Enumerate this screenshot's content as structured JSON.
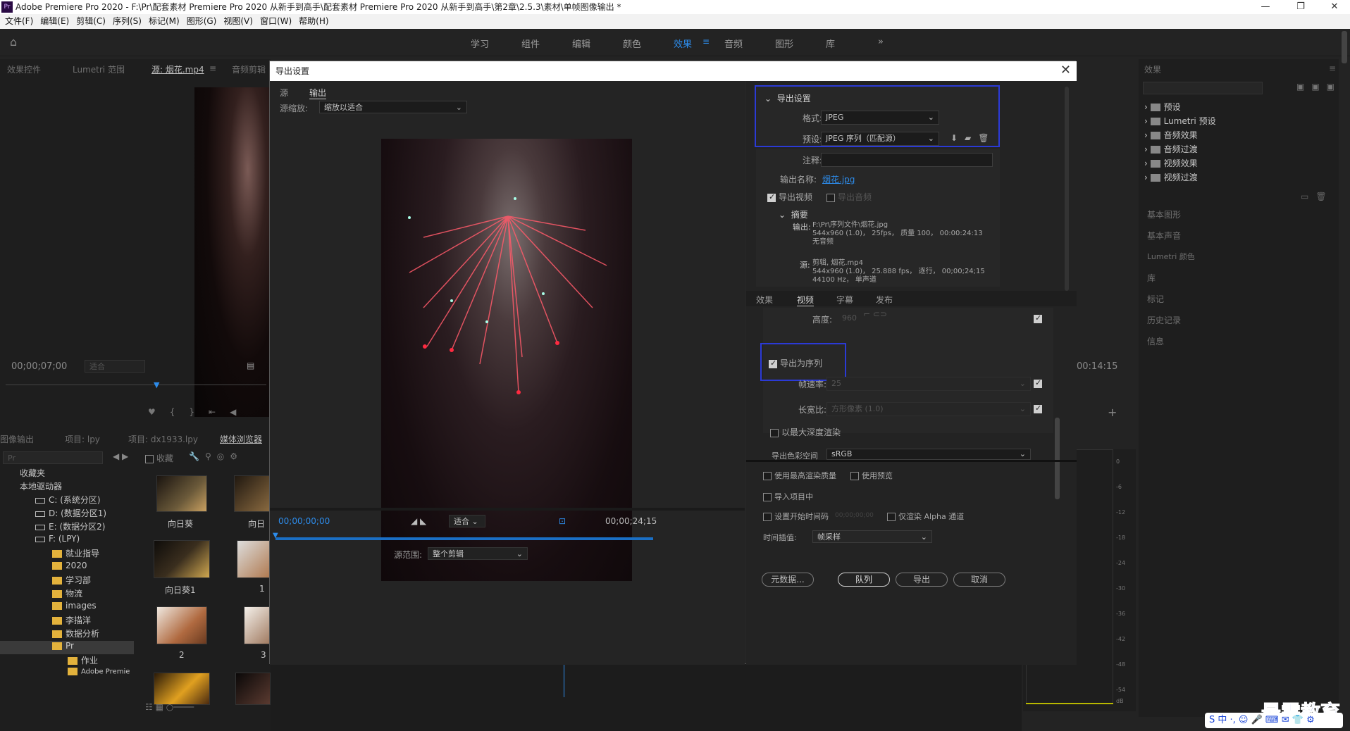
{
  "window": {
    "title": "Adobe Premiere Pro 2020 - F:\\Pr\\配套素材 Premiere Pro 2020 从新手到高手\\配套素材 Premiere Pro 2020 从新手到高手\\第2章\\2.5.3\\素材\\单帧图像输出 *"
  },
  "menu": [
    "文件(F)",
    "编辑(E)",
    "剪辑(C)",
    "序列(S)",
    "标记(M)",
    "图形(G)",
    "视图(V)",
    "窗口(W)",
    "帮助(H)"
  ],
  "workspaces": [
    "学习",
    "组件",
    "编辑",
    "颜色",
    "效果",
    "音频",
    "图形",
    "库"
  ],
  "active_workspace": "效果",
  "source_panel": {
    "tabs": [
      "效果控件",
      "Lumetri 范围",
      "源: 烟花.mp4",
      "音频剪辑"
    ],
    "timecode": "00;00;07;00",
    "fit": "适合"
  },
  "program_timecode_end": "00:14:15",
  "project_panel": {
    "tabs": [
      "图像输出",
      "项目: lpy",
      "项目: dx1933.lpy",
      "媒体浏览器"
    ],
    "search_placeholder": "Pr",
    "favorites_label": "收藏",
    "tree": [
      {
        "label": "收藏夹",
        "type": "root"
      },
      {
        "label": "本地驱动器",
        "type": "root"
      },
      {
        "label": "C: (系统分区)",
        "type": "drive"
      },
      {
        "label": "D: (数据分区1)",
        "type": "drive"
      },
      {
        "label": "E: (数据分区2)",
        "type": "drive"
      },
      {
        "label": "F: (LPY)",
        "type": "drive"
      },
      {
        "label": "就业指导",
        "type": "folder"
      },
      {
        "label": "2020",
        "type": "folder"
      },
      {
        "label": "学习部",
        "type": "folder"
      },
      {
        "label": "物流",
        "type": "folder"
      },
      {
        "label": "images",
        "type": "folder"
      },
      {
        "label": "李描洋",
        "type": "folder"
      },
      {
        "label": "数据分析",
        "type": "folder"
      },
      {
        "label": "Pr",
        "type": "folder"
      },
      {
        "label": "作业",
        "type": "folder"
      },
      {
        "label": "Adobe Premie",
        "type": "folder"
      }
    ],
    "thumbs": [
      "向日葵",
      "向日",
      "向日葵1",
      "1",
      "2",
      "3"
    ]
  },
  "effects_panel": {
    "title": "效果",
    "items": [
      "预设",
      "Lumetri 预设",
      "音频效果",
      "音频过渡",
      "视频效果",
      "视频过渡"
    ],
    "sections": [
      "基本图形",
      "基本声音",
      "Lumetri 颜色",
      "库",
      "标记",
      "历史记录",
      "信息"
    ]
  },
  "audio_meter": {
    "ticks": [
      "0",
      "-6",
      "-12",
      "-18",
      "-24",
      "-30",
      "-36",
      "-42",
      "-48",
      "-54",
      "dB"
    ]
  },
  "dialog": {
    "title": "导出设置",
    "close": "✕",
    "tabs": [
      "源",
      "输出"
    ],
    "source_scaling_label": "源缩放:",
    "source_scaling_value": "缩放以适合",
    "timecode_start": "00;00;00;00",
    "timecode_end": "00;00;24;15",
    "fit": "适合",
    "source_range_label": "源范围:",
    "source_range_value": "整个剪辑",
    "export_settings": {
      "heading": "导出设置",
      "format_label": "格式:",
      "format_value": "JPEG",
      "preset_label": "预设:",
      "preset_value": "JPEG 序列（匹配源）",
      "comment_label": "注释:",
      "output_name_label": "输出名称:",
      "output_name_value": "烟花.jpg",
      "export_video_label": "导出视频",
      "export_audio_label": "导出音频",
      "summary_heading": "摘要",
      "output_label": "输出:",
      "output_line1": "F:\\Pr\\序列文件\\烟花.jpg",
      "output_line2": "544x960 (1.0)， 25fps， 质量 100， 00:00:24:13",
      "output_line3": "无音频",
      "source_label": "源:",
      "source_line1": "剪辑, 烟花.mp4",
      "source_line2": "544x960 (1.0)， 25.888 fps， 逐行， 00;00;24;15",
      "source_line3": "44100 Hz， 单声道"
    },
    "settings_tabs": [
      "效果",
      "视频",
      "字幕",
      "发布"
    ],
    "active_settings_tab": "视频",
    "video": {
      "height_label": "高度:",
      "height_value": "960",
      "export_sequence_label": "导出为序列",
      "frame_rate_label": "帧速率:",
      "frame_rate_value": "25",
      "aspect_label": "长宽比:",
      "aspect_value": "方形像素 (1.0)",
      "max_depth_label": "以最大深度渲染",
      "color_space_label": "导出色彩空间",
      "color_space_value": "sRGB"
    },
    "bottom": {
      "max_quality": "使用最高渲染质量",
      "use_preview": "使用预览",
      "import_project": "导入项目中",
      "set_start_tc": "设置开始时间码",
      "start_tc_value": "00;00;00;00",
      "alpha_only": "仅渲染 Alpha 通道",
      "interp_label": "时间插值:",
      "interp_value": "帧采样",
      "metadata_btn": "元数据...",
      "queue_btn": "队列",
      "export_btn": "导出",
      "cancel_btn": "取消"
    }
  },
  "watermark": "最需教育",
  "colors": {
    "accent": "#2d8ceb",
    "highlight_box": "#2b3ad6",
    "bg": "#232323"
  }
}
